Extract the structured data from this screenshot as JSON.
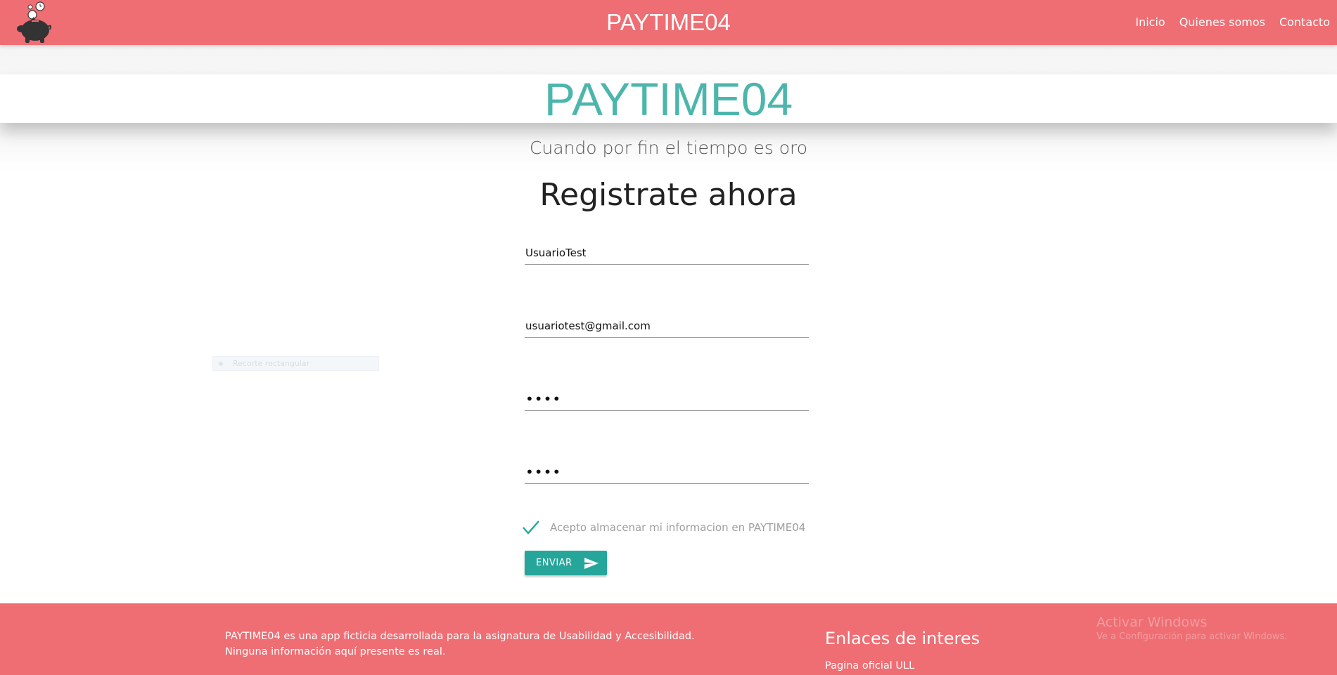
{
  "navbar": {
    "logo_icon": "piggy-bank-clock-icon",
    "brand": "PAYTIME04",
    "links": [
      "Inicio",
      "Quienes somos",
      "Contacto"
    ]
  },
  "hero": {
    "title": "PAYTIME04",
    "subtitle": "Cuando por fin el tiempo es oro"
  },
  "form": {
    "title": "Registrate ahora",
    "username_value": "UsuarioTest",
    "email_value": "usuariotest@gmail.com",
    "password_value": "••••",
    "password_confirm_value": "••••",
    "checkbox_label": "Acepto almacenar mi informacion en PAYTIME04",
    "checkbox_checked": true,
    "submit_label": "ENVIAR",
    "submit_icon": "send-icon"
  },
  "overlay": {
    "label": "Recorte rectangular"
  },
  "footer": {
    "description_line1": "PAYTIME04 es una app ficticia desarrollada para la asignatura de Usabilidad y Accesibilidad.",
    "description_line2": "Ninguna información aquí presente es real.",
    "links_heading": "Enlaces de interes",
    "link1": "Pagina oficial ULL"
  },
  "watermark": {
    "title": "Activar Windows",
    "subtitle": "Ve a Configuración para activar Windows."
  },
  "colors": {
    "primary": "#ee6e73",
    "accent": "#26a69a",
    "hero_title": "#4db6ac"
  }
}
